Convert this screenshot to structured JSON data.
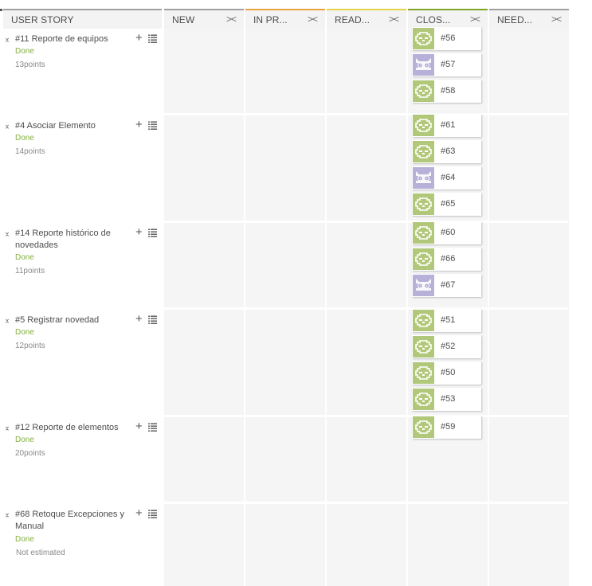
{
  "columns": [
    {
      "label": "USER STORY",
      "accent": "#9f9f9f"
    },
    {
      "label": "NEW",
      "accent": "#9f9f9f"
    },
    {
      "label": "IN PR...",
      "accent": "#e8a33c"
    },
    {
      "label": "READ...",
      "accent": "#e6d24a"
    },
    {
      "label": "CLOS...",
      "accent": "#7fa325"
    },
    {
      "label": "NEED...",
      "accent": "#9f9f9f"
    }
  ],
  "fold_icon": "><",
  "user_stories": [
    {
      "title": "#11 Reporte de equipos",
      "status": "Done",
      "points": "13points"
    },
    {
      "title": "#4 Asociar Elemento",
      "status": "Done",
      "points": "14points"
    },
    {
      "title": "#14 Reporte histórico de novedades",
      "status": "Done",
      "points": "11points"
    },
    {
      "title": "#5 Registrar novedad",
      "status": "Done",
      "points": "12points"
    },
    {
      "title": "#12 Reporte de elementos",
      "status": "Done",
      "points": "20points"
    },
    {
      "title": "#68 Retoque Excepciones y Manual",
      "status": "Done",
      "points": "Not estimated"
    }
  ],
  "tasks": [
    {
      "ref": "#56",
      "avatar": "green-owl-avatar"
    },
    {
      "ref": "#57",
      "avatar": "purple-owl-avatar"
    },
    {
      "ref": "#58",
      "avatar": "green-owl-avatar"
    },
    {
      "ref": "#61",
      "avatar": "green-owl-avatar"
    },
    {
      "ref": "#63",
      "avatar": "green-owl-avatar"
    },
    {
      "ref": "#64",
      "avatar": "purple-owl-avatar"
    },
    {
      "ref": "#65",
      "avatar": "green-owl-avatar"
    },
    {
      "ref": "#60",
      "avatar": "green-owl-avatar"
    },
    {
      "ref": "#66",
      "avatar": "green-owl-avatar"
    },
    {
      "ref": "#67",
      "avatar": "purple-owl-avatar"
    },
    {
      "ref": "#51",
      "avatar": "green-owl-avatar"
    },
    {
      "ref": "#52",
      "avatar": "green-owl-avatar"
    },
    {
      "ref": "#50",
      "avatar": "green-owl-avatar"
    },
    {
      "ref": "#53",
      "avatar": "green-owl-avatar"
    },
    {
      "ref": "#59",
      "avatar": "green-owl-avatar"
    }
  ],
  "colors": {
    "done_status": "#83b23f",
    "avatar_green": "#b1c87a",
    "avatar_purple": "#b7b0d8",
    "column_bg": "#f5f5f5"
  }
}
